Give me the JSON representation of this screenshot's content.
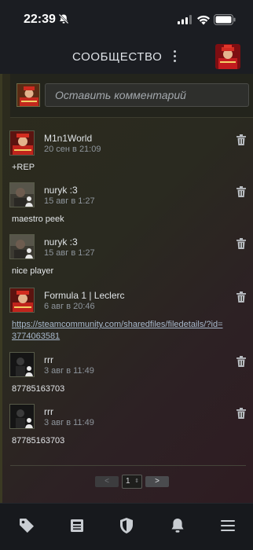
{
  "status_bar": {
    "time": "22:39"
  },
  "header": {
    "title": "СООБЩЕСТВО"
  },
  "compose": {
    "placeholder": "Оставить комментарий"
  },
  "comments": [
    {
      "author": "M1n1World",
      "date": "20 сен в 21:09",
      "text": "+REP",
      "avatar": "red-character"
    },
    {
      "author": "nuryk :3",
      "date": "15 авг в 1:27",
      "text": "maestro peek",
      "avatar": "person-photo"
    },
    {
      "author": "nuryk :3",
      "date": "15 авг в 1:27",
      "text": "nice player",
      "avatar": "person-photo"
    },
    {
      "author": "Formula 1 | Leclerc",
      "date": "6 авг в 20:46",
      "text": "https://steamcommunity.com/sharedfiles/filedetails/?id=3774063581",
      "avatar": "red-character"
    },
    {
      "author": "rrr",
      "date": "3 авг в 11:49",
      "text": "87785163703",
      "avatar": "dark-figure"
    },
    {
      "author": "rrr",
      "date": "3 авг в 11:49",
      "text": "87785163703",
      "avatar": "dark-figure"
    }
  ],
  "pagination": {
    "prev": "<",
    "current": "1",
    "next": ">"
  },
  "bottom_nav": [
    "tag-icon",
    "news-icon",
    "shield-icon",
    "bell-icon",
    "menu-icon"
  ],
  "colors": {
    "link": "#a8b9cc",
    "panel_start": "#2c2b1d",
    "panel_end": "#2e1c22"
  }
}
